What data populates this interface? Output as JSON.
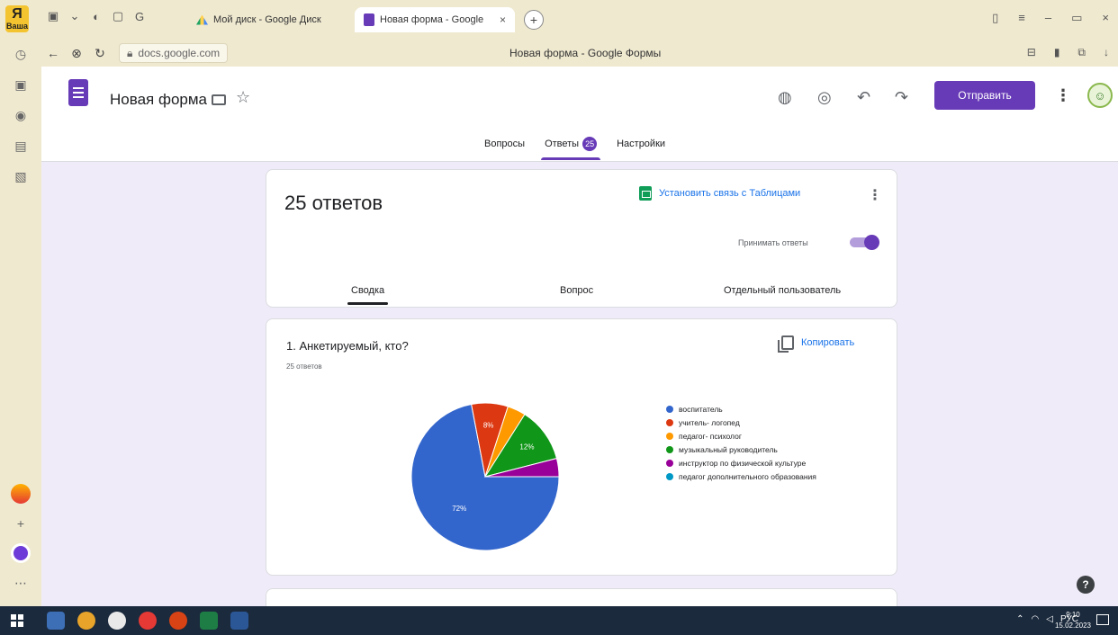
{
  "browser": {
    "tabs": [
      {
        "label": "Мой диск - Google Диск",
        "active": false
      },
      {
        "label": "Новая форма - Google",
        "active": true
      }
    ],
    "close_glyph": "×",
    "newtab_glyph": "+",
    "url": "docs.google.com",
    "page_title": "Новая форма - Google Формы"
  },
  "yandex": {
    "logo_text": "Я",
    "logo_sub": "Ваша"
  },
  "header": {
    "form_name": "Новая форма",
    "send_label": "Отправить",
    "more_glyph": "⋮"
  },
  "nav_tabs": [
    {
      "label": "Вопросы"
    },
    {
      "label": "Ответы",
      "badge": "25",
      "active": true
    },
    {
      "label": "Настройки"
    }
  ],
  "responses": {
    "count_label": "25 ответов",
    "link_sheets_label": "Установить связь с Таблицами",
    "accept_label": "Принимать ответы",
    "accepting": true,
    "sub_tabs": [
      {
        "label": "Сводка",
        "active": true
      },
      {
        "label": "Вопрос"
      },
      {
        "label": "Отдельный пользователь"
      }
    ]
  },
  "question": {
    "title": "1. Анкетируемый, кто?",
    "count": "25 ответов",
    "copy_label": "Копировать"
  },
  "chart_data": {
    "type": "pie",
    "categories": [
      "воспитатель",
      "учитель- логопед",
      "педагог- психолог",
      "музыкальный руководитель",
      "инструктор по физической культуре",
      "педагог дополнительного образования"
    ],
    "values": [
      72,
      8,
      4,
      12,
      4,
      0
    ],
    "labels_shown": [
      "72%",
      "8%",
      "12%"
    ],
    "colors": [
      "#3366cc",
      "#dc3912",
      "#ff9900",
      "#109618",
      "#990099",
      "#0099c6"
    ],
    "legend_position": "right"
  },
  "taskbar": {
    "tray_lang": "РУС",
    "time": "9:10",
    "date": "15.02.2023"
  },
  "colors": {
    "accent": "#673ab7",
    "link": "#1a73e8",
    "app_bg": "#f0ebf8"
  },
  "icons": {
    "help": "?"
  }
}
